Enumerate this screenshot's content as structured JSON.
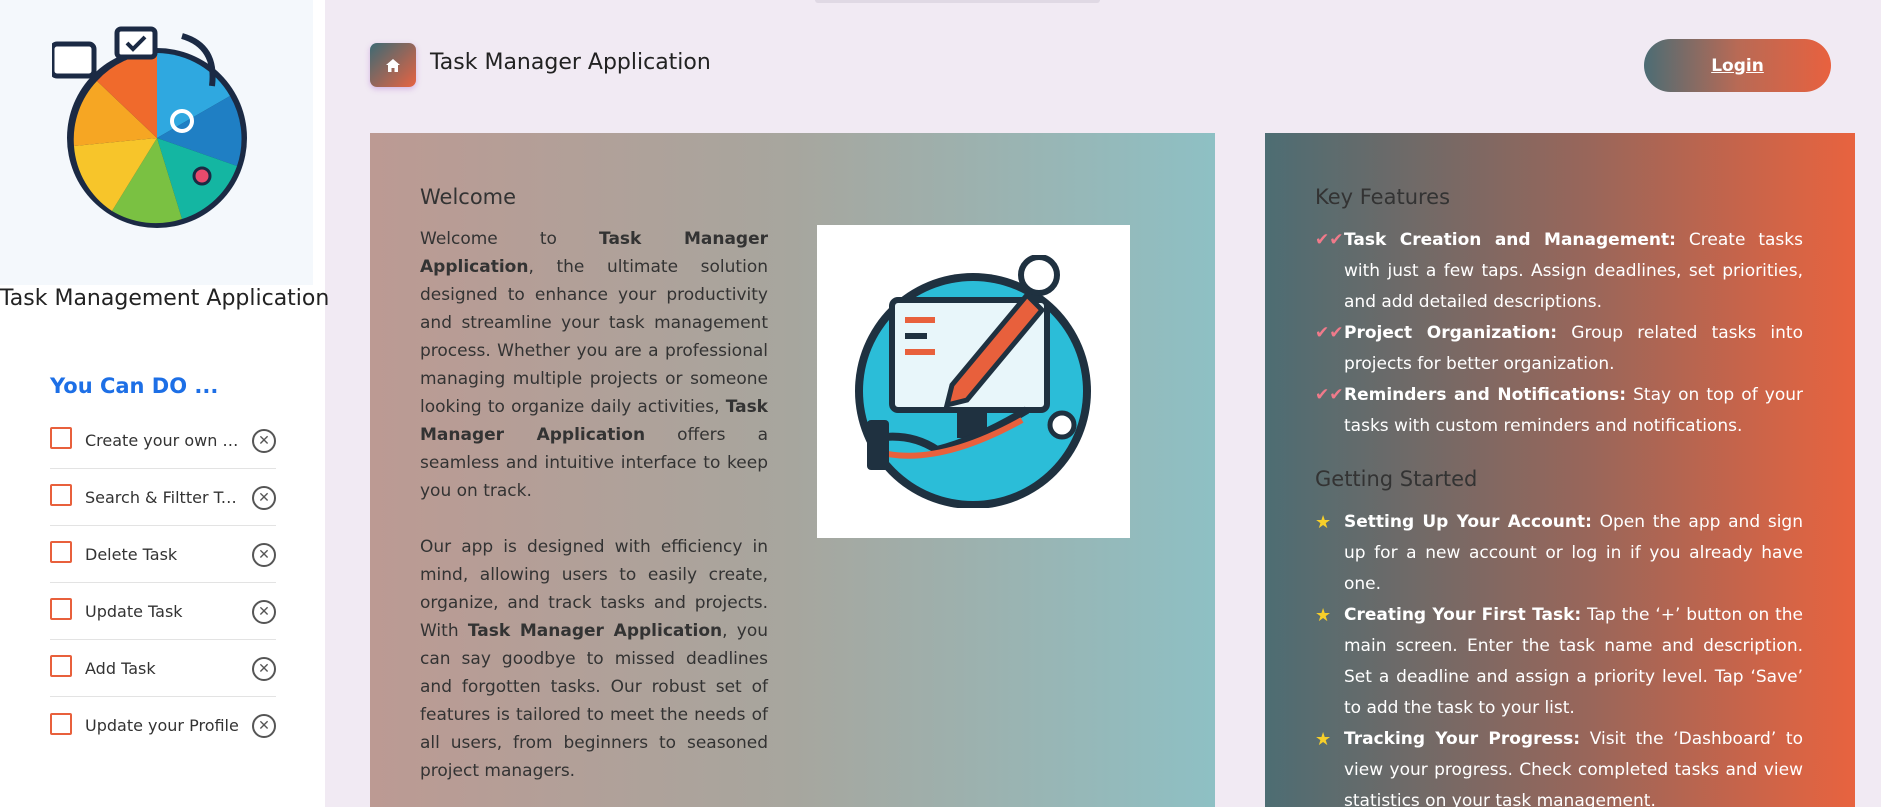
{
  "sidebar": {
    "app_name": "Task Management Application",
    "can_do_title": "You Can DO ...",
    "items": [
      {
        "label": "Create your own Task"
      },
      {
        "label": "Search & Filtter Task"
      },
      {
        "label": "Delete Task"
      },
      {
        "label": "Update Task"
      },
      {
        "label": "Add Task"
      },
      {
        "label": "Update your Profile"
      }
    ]
  },
  "header": {
    "title": "Task Manager Application",
    "login_label": "Login",
    "home_icon": "home-icon"
  },
  "welcome": {
    "title": "Welcome",
    "p1_a": "Welcome to ",
    "p1_b": "Task Manager Application",
    "p1_c": ", the ultimate solution designed to enhance your productivity and streamline your task management process. Whether you are a professional managing multiple projects or someone looking to organize daily activities, ",
    "p1_d": "Task Manager Application",
    "p1_e": " offers a seamless and intuitive interface to keep you on track.",
    "p2_a": "Our app is designed with efficiency in mind, allowing users to easily create, organize, and track tasks and projects. With ",
    "p2_b": "Task Manager Application",
    "p2_c": ", you can say goodbye to missed deadlines and forgotten tasks. Our robust set of features is tailored to meet the needs of all users, from beginners to seasoned project managers."
  },
  "features": {
    "key_title": "Key Features",
    "key_items": [
      {
        "bold": "Task Creation and Management:",
        "text": " Create tasks with just a few taps. Assign deadlines, set priorities, and add detailed descriptions."
      },
      {
        "bold": "Project Organization:",
        "text": " Group related tasks into projects for better organization."
      },
      {
        "bold": "Reminders and Notifications:",
        "text": " Stay on top of your tasks with custom reminders and notifications."
      }
    ],
    "start_title": "Getting Started",
    "start_items": [
      {
        "bold": "Setting Up Your Account:",
        "text": " Open the app and sign up for a new account or log in if you already have one."
      },
      {
        "bold": "Creating Your First Task:",
        "text": " Tap the ‘+’ button on the main screen. Enter the task name and description. Set a deadline and assign a priority level. Tap ‘Save’ to add the task to your list."
      },
      {
        "bold": "Tracking Your Progress:",
        "text": " Visit the ‘Dashboard’ to view your progress. Check completed tasks and view statistics on your task management."
      }
    ]
  },
  "colors": {
    "accent_blue": "#1d6fe6",
    "accent_orange": "#e8633f",
    "teal": "#4d6d73"
  }
}
